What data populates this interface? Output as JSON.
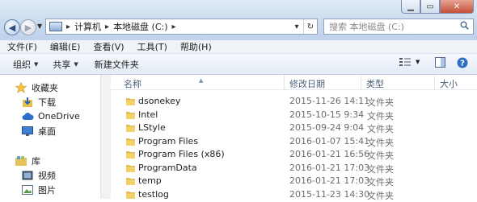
{
  "window": {
    "controls": [
      "minimize",
      "maximize",
      "close"
    ]
  },
  "nav": {
    "breadcrumb": [
      "计算机",
      "本地磁盘 (C:)"
    ],
    "search_placeholder": "搜索 本地磁盘 (C:)"
  },
  "menu": [
    "文件(F)",
    "编辑(E)",
    "查看(V)",
    "工具(T)",
    "帮助(H)"
  ],
  "toolbar": {
    "organize": "组织",
    "share": "共享",
    "new_folder": "新建文件夹"
  },
  "sidebar": {
    "favorites": "收藏夹",
    "items": [
      "下载",
      "OneDrive",
      "桌面"
    ],
    "libraries": "库",
    "lib_items": [
      "视频",
      "图片"
    ]
  },
  "columns": {
    "name": "名称",
    "date": "修改日期",
    "type": "类型",
    "size": "大小"
  },
  "files": [
    {
      "name": "dsonekey",
      "date": "2015-11-26 14:11",
      "type": "文件夹"
    },
    {
      "name": "Intel",
      "date": "2015-10-15 9:34",
      "type": "文件夹"
    },
    {
      "name": "LStyle",
      "date": "2015-09-24 9:04",
      "type": "文件夹"
    },
    {
      "name": "Program Files",
      "date": "2016-01-07 15:41",
      "type": "文件夹"
    },
    {
      "name": "Program Files (x86)",
      "date": "2016-01-21 16:56",
      "type": "文件夹"
    },
    {
      "name": "ProgramData",
      "date": "2016-01-21 17:03",
      "type": "文件夹"
    },
    {
      "name": "temp",
      "date": "2016-01-21 17:03",
      "type": "文件夹"
    },
    {
      "name": "testlog",
      "date": "2015-11-23 14:30",
      "type": "文件夹"
    }
  ],
  "colors": {
    "folder": "#e8c04a",
    "accent": "#1e5aa8"
  }
}
